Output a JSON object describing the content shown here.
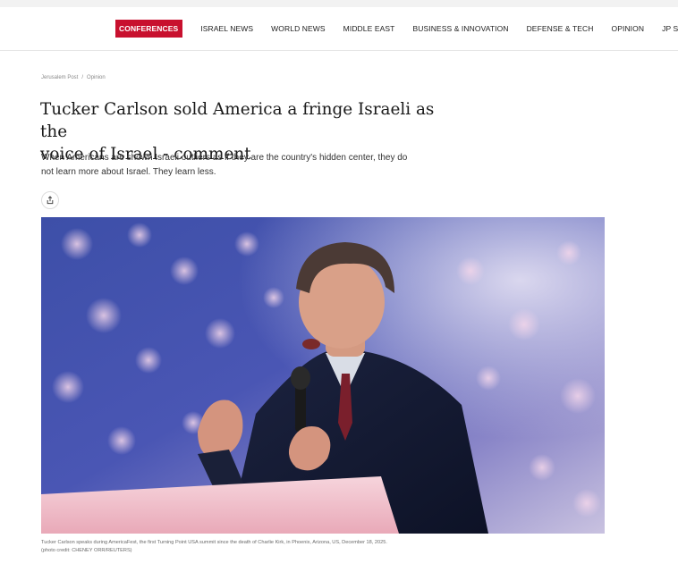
{
  "nav": {
    "items": [
      {
        "label": "CONFERENCES",
        "highlighted": true
      },
      {
        "label": "ISRAEL NEWS"
      },
      {
        "label": "WORLD NEWS"
      },
      {
        "label": "MIDDLE EAST"
      },
      {
        "label": "BUSINESS & INNOVATION"
      },
      {
        "label": "DEFENSE & TECH"
      },
      {
        "label": "OPINION"
      },
      {
        "label": "JP STORE"
      }
    ],
    "accent_color": "#c8102e"
  },
  "breadcrumb": {
    "home": "Jerusalem Post",
    "separator": "/",
    "section": "Opinion"
  },
  "article": {
    "headline_line1": "Tucker Carlson sold America a fringe Israeli as the",
    "headline_line2": "voice of Israel - comment",
    "dek_line1": "When Americans are shown Israeli outliers as if they are the country's hidden center, they do",
    "dek_line2": "not learn more about Israel. They learn less."
  },
  "share": {
    "icon": "share-icon"
  },
  "hero_image": {
    "caption_line1": "Tucker Carlson speaks during AmericaFest, the first Turning Point USA summit since the death of Charlie Kirk, in Phoenix, Arizona, US, December 18, 2025.",
    "caption_line2": "(photo credit: CHENEY ORR/REUTERS)"
  }
}
